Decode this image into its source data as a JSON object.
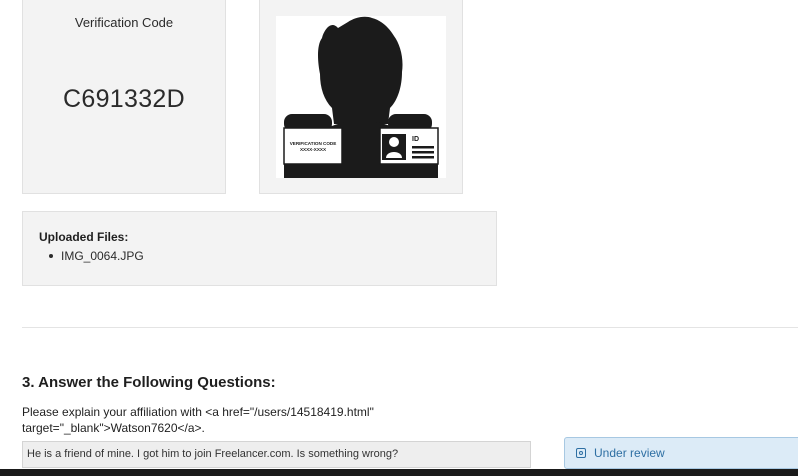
{
  "verification": {
    "title": "Verification Code",
    "code": "C691332D"
  },
  "photo": {
    "card_text_line1": "VERIFICATION CODE",
    "card_text_line2": "XXXX-XXXX",
    "id_label": "ID"
  },
  "uploaded": {
    "title": "Uploaded Files:",
    "files": [
      "IMG_0064.JPG"
    ]
  },
  "questions": {
    "heading": "3. Answer the Following Questions:",
    "prompt": "Please explain your affiliation with <a href=\"/users/14518419.html\" target=\"_blank\">Watson7620</a>.",
    "answer": "He is a friend of mine. I got him to join Freelancer.com. Is something wrong?"
  },
  "review": {
    "status": "Under review",
    "icon": "review-status-icon"
  },
  "colors": {
    "card_bg": "#f3f3f3",
    "review_bg": "#dcebf7",
    "review_text": "#2e6fa3"
  }
}
